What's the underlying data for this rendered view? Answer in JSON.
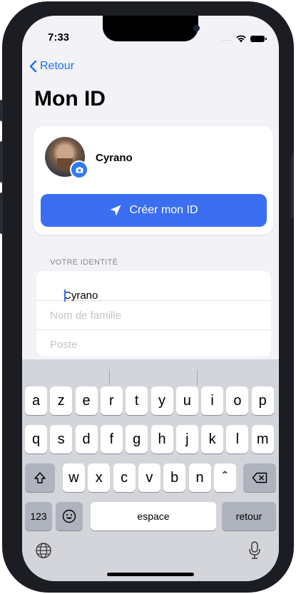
{
  "status": {
    "time": "7:33",
    "signal": "...."
  },
  "nav": {
    "back_label": "Retour"
  },
  "page": {
    "title": "Mon ID"
  },
  "profile": {
    "name": "Cyrano",
    "create_button_label": "Créer mon ID"
  },
  "identity": {
    "section_label": "VOTRE IDENTITÉ",
    "first_name_value": "Cyrano",
    "last_name_placeholder": "Nom de famille",
    "position_placeholder": "Poste"
  },
  "keyboard": {
    "row1": [
      "a",
      "z",
      "e",
      "r",
      "t",
      "y",
      "u",
      "i",
      "o",
      "p"
    ],
    "row2": [
      "q",
      "s",
      "d",
      "f",
      "g",
      "h",
      "j",
      "k",
      "l",
      "m"
    ],
    "row3": [
      "w",
      "x",
      "c",
      "v",
      "b",
      "n",
      "ˆ"
    ],
    "numbers_label": "123",
    "space_label": "espace",
    "return_label": "retour"
  },
  "colors": {
    "accent": "#3b6ef0",
    "link": "#1a73e8",
    "background": "#f2f2f7"
  }
}
